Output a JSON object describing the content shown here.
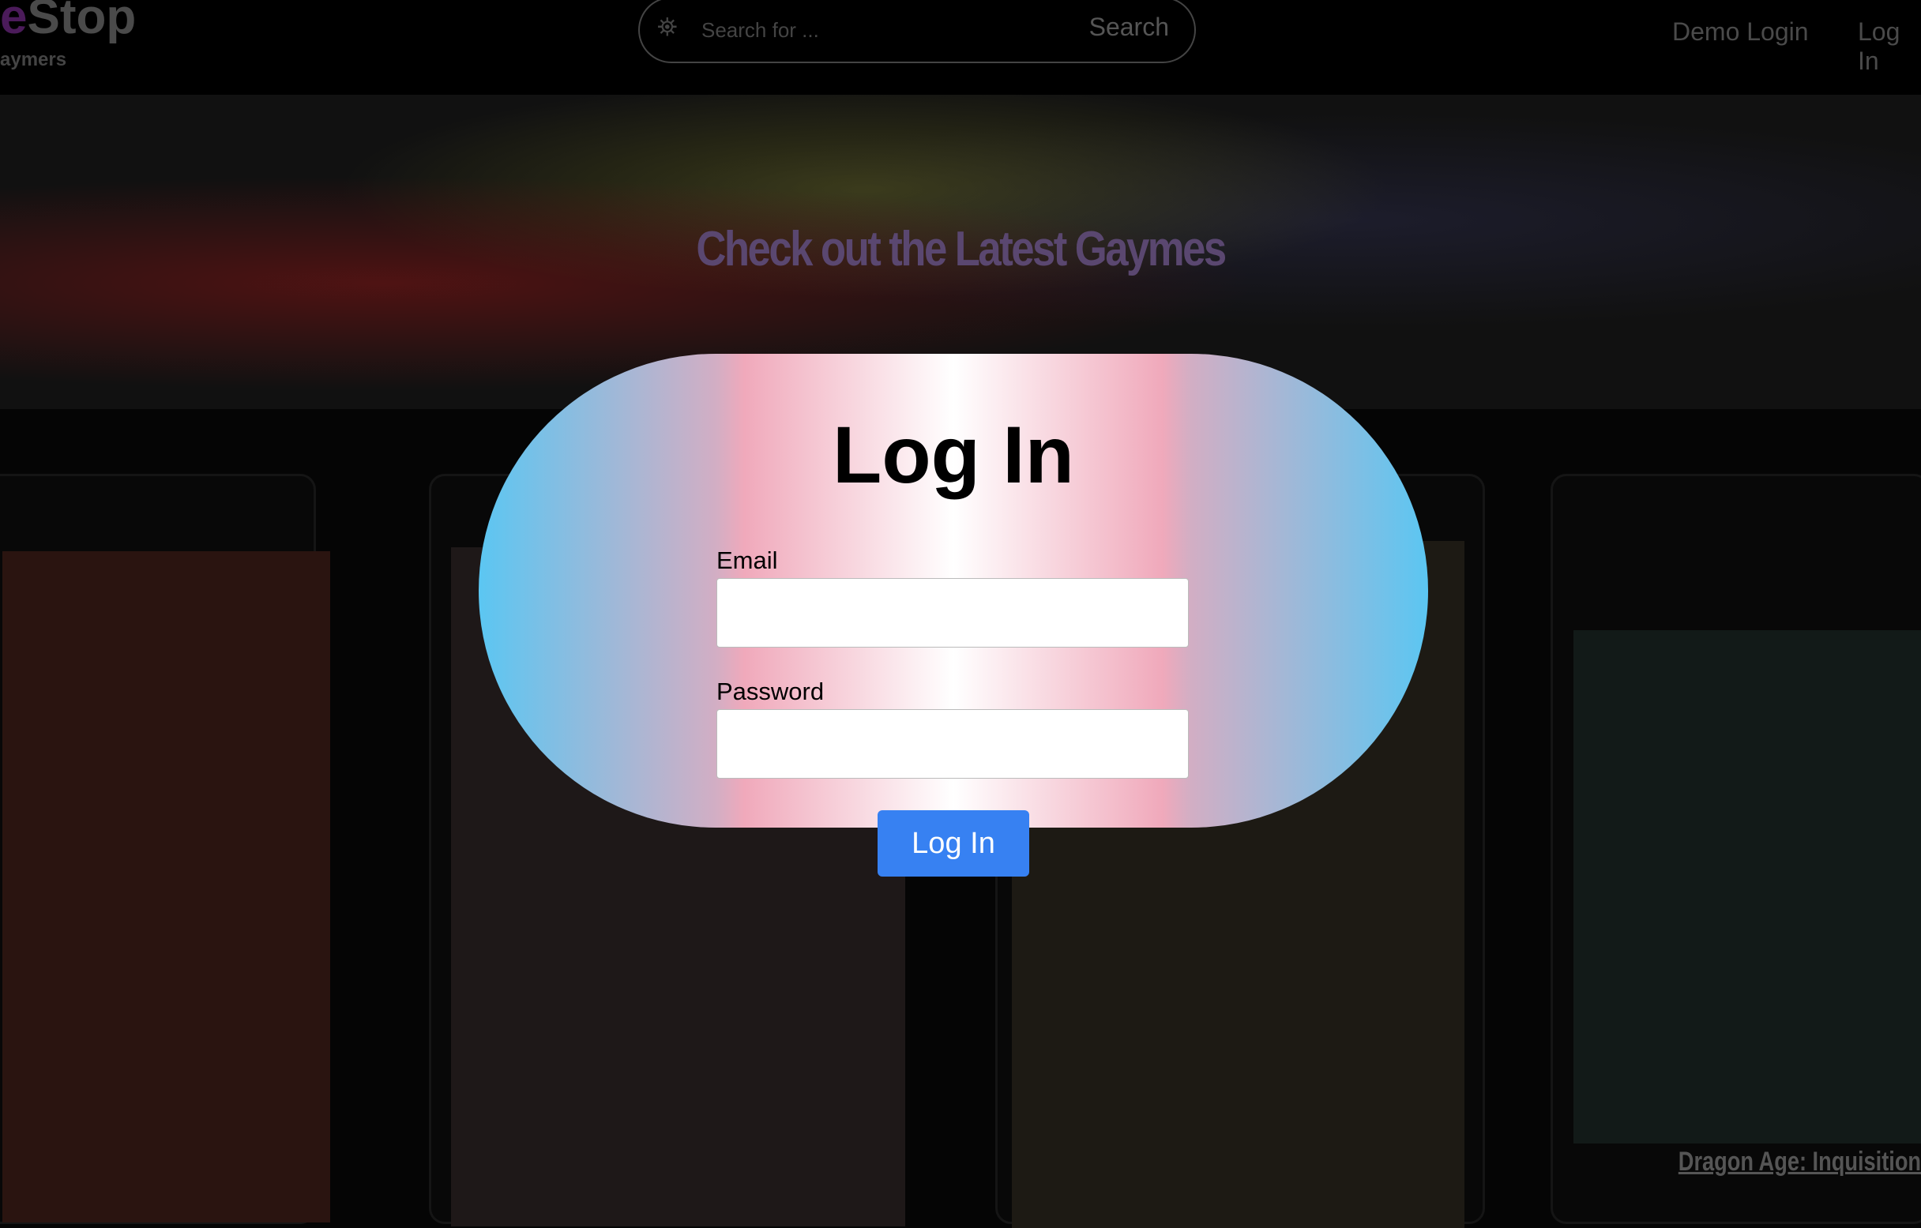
{
  "header": {
    "logo_prefix": "e",
    "logo_text": "Stop",
    "tagline": "aymers",
    "search_placeholder": "Search for ...",
    "search_button": "Search",
    "nav": [
      "Demo Login",
      "Log In"
    ]
  },
  "banner": {
    "heading": "Check out the Latest Gaymes"
  },
  "cards": [
    {
      "title": "Dragon Age: Inquisition"
    }
  ],
  "modal": {
    "title": "Log In",
    "email_label": "Email",
    "password_label": "Password",
    "submit": "Log In",
    "email_value": "",
    "password_value": ""
  },
  "colors": {
    "button": "#3781f2",
    "flag_blue": "#5bc6f2",
    "flag_pink": "#f0a9bb",
    "flag_white": "#ffffff"
  }
}
